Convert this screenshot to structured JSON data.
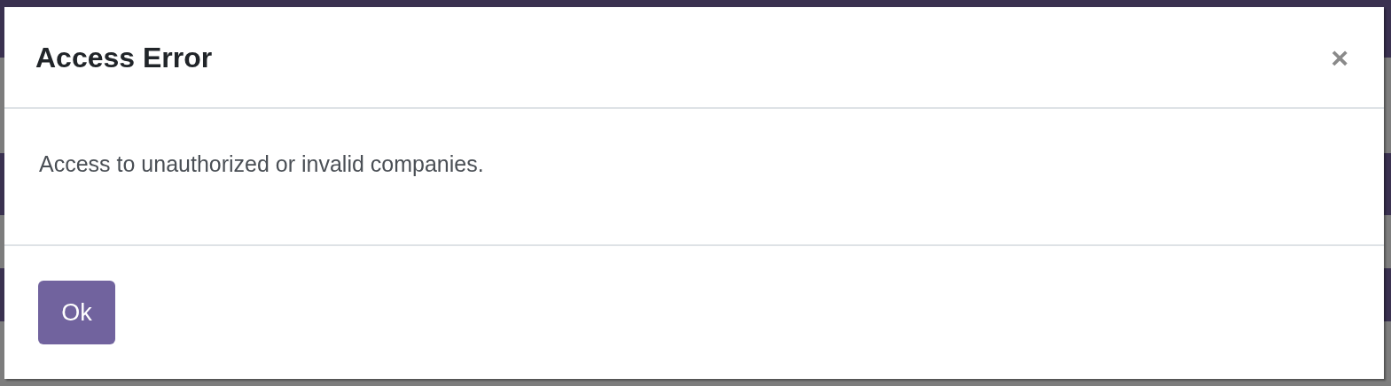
{
  "dialog": {
    "title": "Access Error",
    "close": "×",
    "message": "Access to unauthorized or invalid companies.",
    "buttons": [
      {
        "label": "Ok"
      }
    ]
  }
}
